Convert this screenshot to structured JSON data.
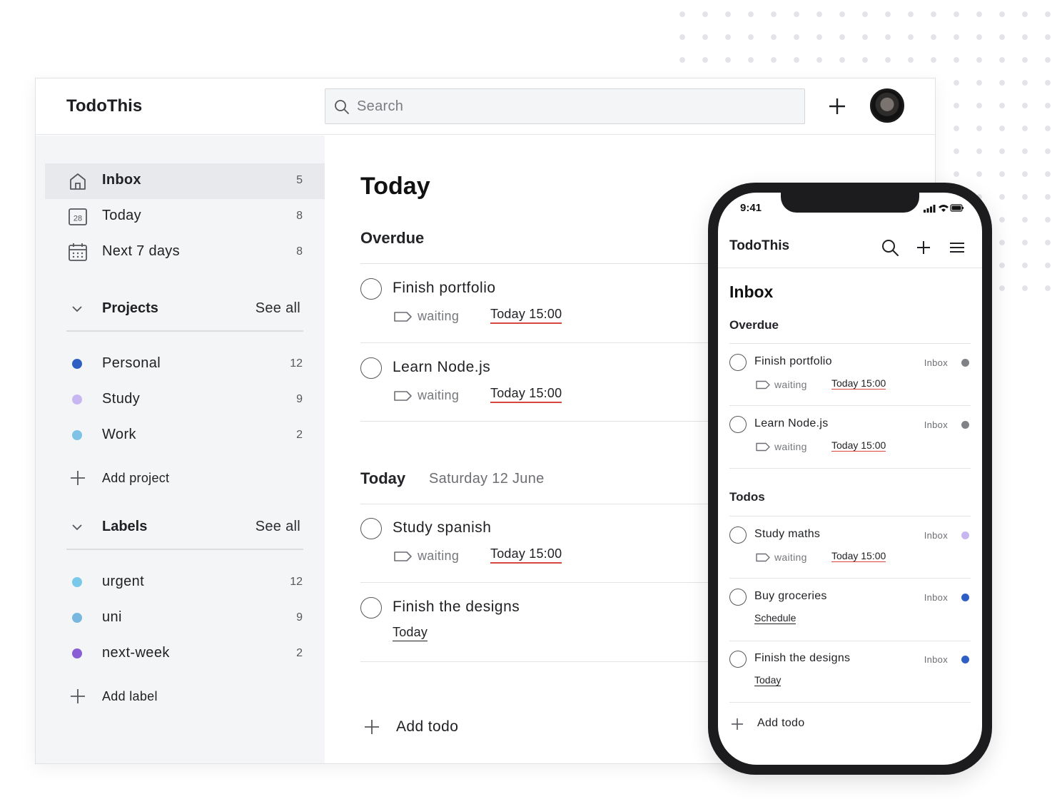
{
  "app": {
    "title": "TodoThis"
  },
  "search": {
    "placeholder": "Search",
    "value": ""
  },
  "sidebar": {
    "nav": [
      {
        "label": "Inbox",
        "count": "5",
        "icon": "home-icon",
        "active": true
      },
      {
        "label": "Today",
        "count": "8",
        "icon": "calendar-day-icon",
        "icon_text": "28"
      },
      {
        "label": "Next 7 days",
        "count": "8",
        "icon": "calendar-week-icon"
      }
    ],
    "projects": {
      "title": "Projects",
      "see_all": "See all",
      "items": [
        {
          "label": "Personal",
          "count": "12",
          "color": "#2f5fc4"
        },
        {
          "label": "Study",
          "count": "9",
          "color": "#c8b6f0"
        },
        {
          "label": "Work",
          "count": "2",
          "color": "#7ec3e6"
        }
      ],
      "add_label": "Add project"
    },
    "labels": {
      "title": "Labels",
      "see_all": "See all",
      "items": [
        {
          "label": "urgent",
          "count": "12",
          "color": "#79c8ea"
        },
        {
          "label": "uni",
          "count": "9",
          "color": "#78b8e0"
        },
        {
          "label": "next-week",
          "count": "2",
          "color": "#8a5fd6"
        }
      ],
      "add_label": "Add label"
    }
  },
  "main": {
    "title": "Today",
    "overdue": {
      "title": "Overdue",
      "tasks": [
        {
          "name": "Finish portfolio",
          "tag": "waiting",
          "due": "Today 15:00"
        },
        {
          "name": "Learn Node.js",
          "tag": "waiting",
          "due": "Today 15:00"
        }
      ]
    },
    "today": {
      "title": "Today",
      "subtitle": "Saturday 12 June",
      "tasks": [
        {
          "name": "Study spanish",
          "tag": "waiting",
          "due": "Today 15:00"
        },
        {
          "name": "Finish the designs",
          "due": "Today"
        }
      ]
    },
    "add_todo": "Add todo"
  },
  "phone": {
    "time": "9:41",
    "title": "TodoThis",
    "page_title": "Inbox",
    "overdue": {
      "title": "Overdue",
      "tasks": [
        {
          "name": "Finish portfolio",
          "project": "Inbox",
          "dot_color": "#808288",
          "tag": "waiting",
          "due": "Today 15:00"
        },
        {
          "name": "Learn Node.js",
          "project": "Inbox",
          "dot_color": "#808288",
          "tag": "waiting",
          "due": "Today 15:00"
        }
      ]
    },
    "todos": {
      "title": "Todos",
      "tasks": [
        {
          "name": "Study maths",
          "project": "Inbox",
          "dot_color": "#c8b6f0",
          "tag": "waiting",
          "due": "Today 15:00"
        },
        {
          "name": "Buy groceries",
          "project": "Inbox",
          "dot_color": "#2f5fc4",
          "due": "Schedule"
        },
        {
          "name": "Finish the designs",
          "project": "Inbox",
          "dot_color": "#2f5fc4",
          "due": "Today"
        }
      ]
    },
    "add_todo": "Add todo"
  },
  "colors": {
    "due_underline": "#d8453c",
    "sidebar_bg": "#f4f5f6",
    "active_nav_bg": "#e8e9ec"
  }
}
